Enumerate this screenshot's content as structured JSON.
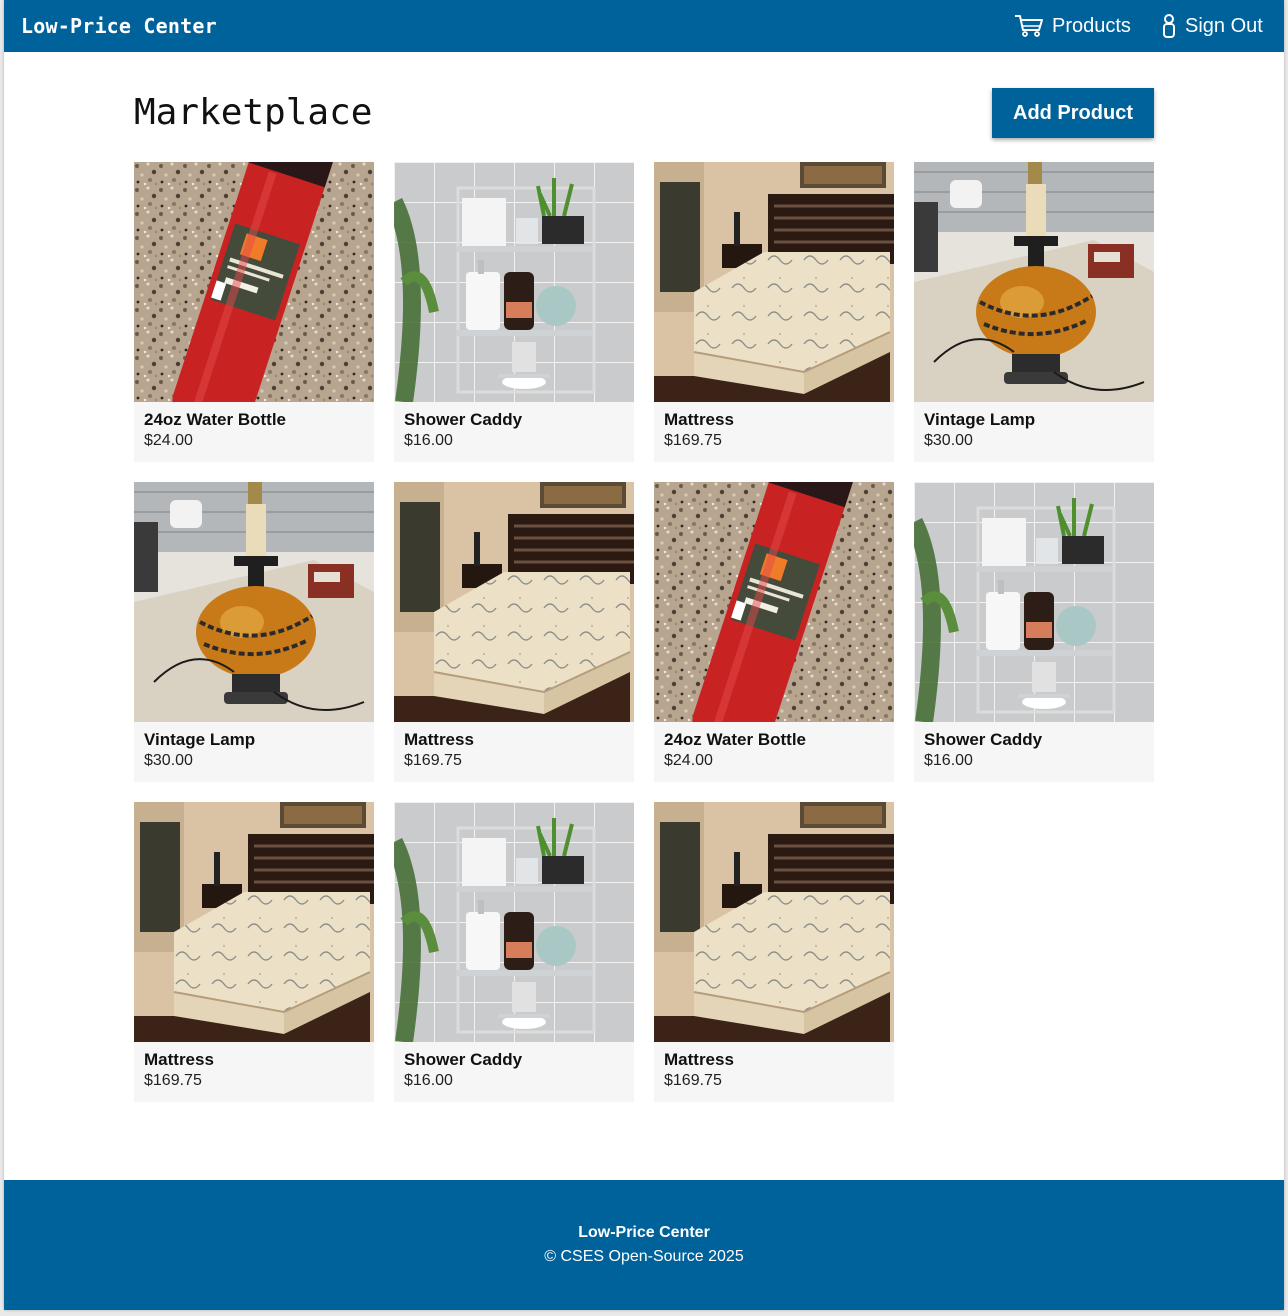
{
  "app": {
    "brand": "Low-Price Center",
    "colors": {
      "primary": "#00629b",
      "card_bg": "#f6f6f6",
      "text": "#111111"
    }
  },
  "nav": {
    "products": {
      "label": "Products",
      "icon": "cart-icon"
    },
    "signout": {
      "label": "Sign Out",
      "icon": "person-icon"
    }
  },
  "page": {
    "title": "Marketplace",
    "add_button": "Add Product"
  },
  "products": [
    {
      "name": "24oz Water Bottle",
      "price": "$24.00",
      "image": "water-bottle"
    },
    {
      "name": "Shower Caddy",
      "price": "$16.00",
      "image": "shower-caddy"
    },
    {
      "name": "Mattress",
      "price": "$169.75",
      "image": "mattress"
    },
    {
      "name": "Vintage Lamp",
      "price": "$30.00",
      "image": "vintage-lamp"
    },
    {
      "name": "Vintage Lamp",
      "price": "$30.00",
      "image": "vintage-lamp"
    },
    {
      "name": "Mattress",
      "price": "$169.75",
      "image": "mattress"
    },
    {
      "name": "24oz Water Bottle",
      "price": "$24.00",
      "image": "water-bottle"
    },
    {
      "name": "Shower Caddy",
      "price": "$16.00",
      "image": "shower-caddy"
    },
    {
      "name": "Mattress",
      "price": "$169.75",
      "image": "mattress"
    },
    {
      "name": "Shower Caddy",
      "price": "$16.00",
      "image": "shower-caddy"
    },
    {
      "name": "Mattress",
      "price": "$169.75",
      "image": "mattress"
    }
  ],
  "footer": {
    "title": "Low-Price Center",
    "copyright": "© CSES Open-Source 2025"
  }
}
